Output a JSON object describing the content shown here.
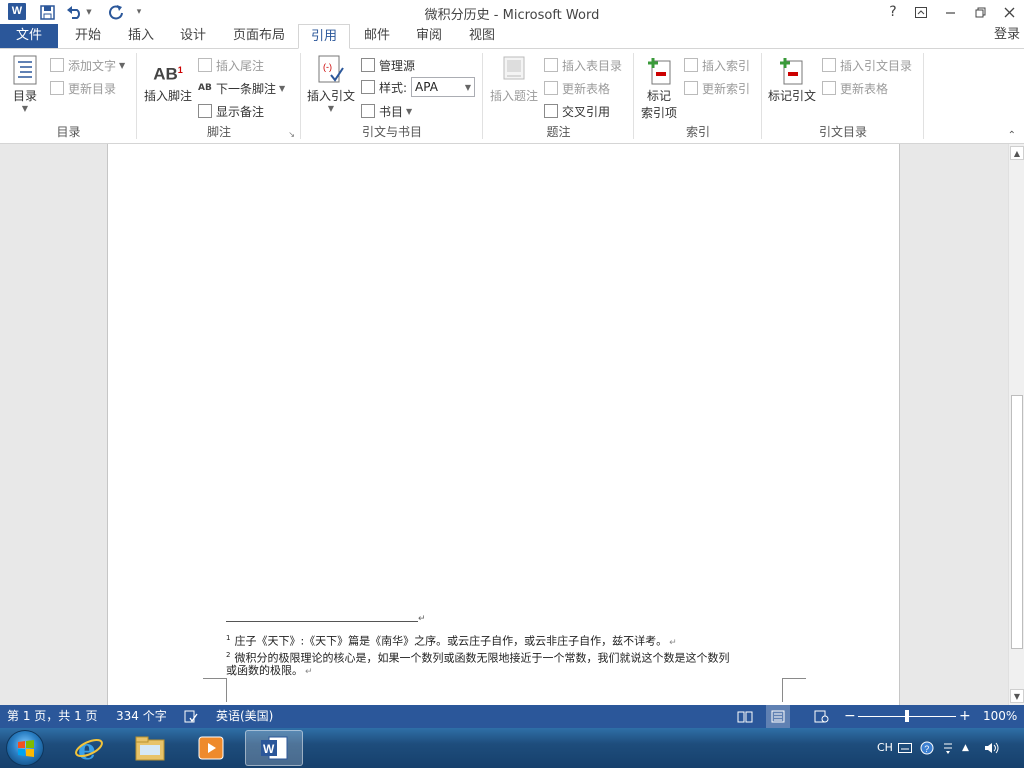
{
  "window": {
    "title": "微积分历史 - Microsoft Word",
    "help": "?",
    "controls": [
      "minimize",
      "restore",
      "close"
    ]
  },
  "tabs": {
    "file": "文件",
    "items": [
      "开始",
      "插入",
      "设计",
      "页面布局",
      "引用",
      "邮件",
      "审阅",
      "视图"
    ],
    "active": "引用",
    "login": "登录"
  },
  "ribbon": {
    "toc": {
      "label": "目录",
      "toc_button": "目录",
      "add_text": "添加文字",
      "update_table": "更新目录"
    },
    "footnotes": {
      "label": "脚注",
      "insert_footnote": "插入脚注",
      "insert_endnote": "插入尾注",
      "next_footnote": "下一条脚注",
      "show_notes": "显示备注"
    },
    "citations": {
      "label": "引文与书目",
      "insert_citation": "插入引文",
      "manage_sources": "管理源",
      "style_label": "样式:",
      "style_value": "APA",
      "bibliography": "书目"
    },
    "captions": {
      "label": "题注",
      "insert_caption": "插入题注",
      "insert_table_of_figures": "插入表目录",
      "update_table": "更新表格",
      "cross_reference": "交叉引用"
    },
    "index": {
      "label": "索引",
      "mark_entry_line1": "标记",
      "mark_entry_line2": "索引项",
      "insert_index": "插入索引",
      "update_index": "更新索引"
    },
    "authorities": {
      "label": "引文目录",
      "mark_citation": "标记引文",
      "insert_table": "插入引文目录",
      "update_table": "更新表格"
    }
  },
  "document": {
    "footnotes": [
      {
        "num": "1",
        "text": "庄子《天下》:《天下》篇是《南华》之序。或云庄子自作，或云非庄子自作，兹不详考。"
      },
      {
        "num": "2",
        "text": "微积分的极限理论的核心是，如果一个数列或函数无限地接近于一个常数，我们就说这个数是这个数列"
      },
      {
        "num": "",
        "text": "或函数的极限。"
      }
    ]
  },
  "statusbar": {
    "page": "第 1 页，共 1 页",
    "words": "334 个字",
    "language": "英语(美国)",
    "zoom": "100%",
    "zoom_level": 0.5
  },
  "taskbar": {
    "apps": [
      "ie-icon",
      "explorer-icon",
      "media-player-icon",
      "word-icon"
    ],
    "tray_lang": "CH"
  }
}
